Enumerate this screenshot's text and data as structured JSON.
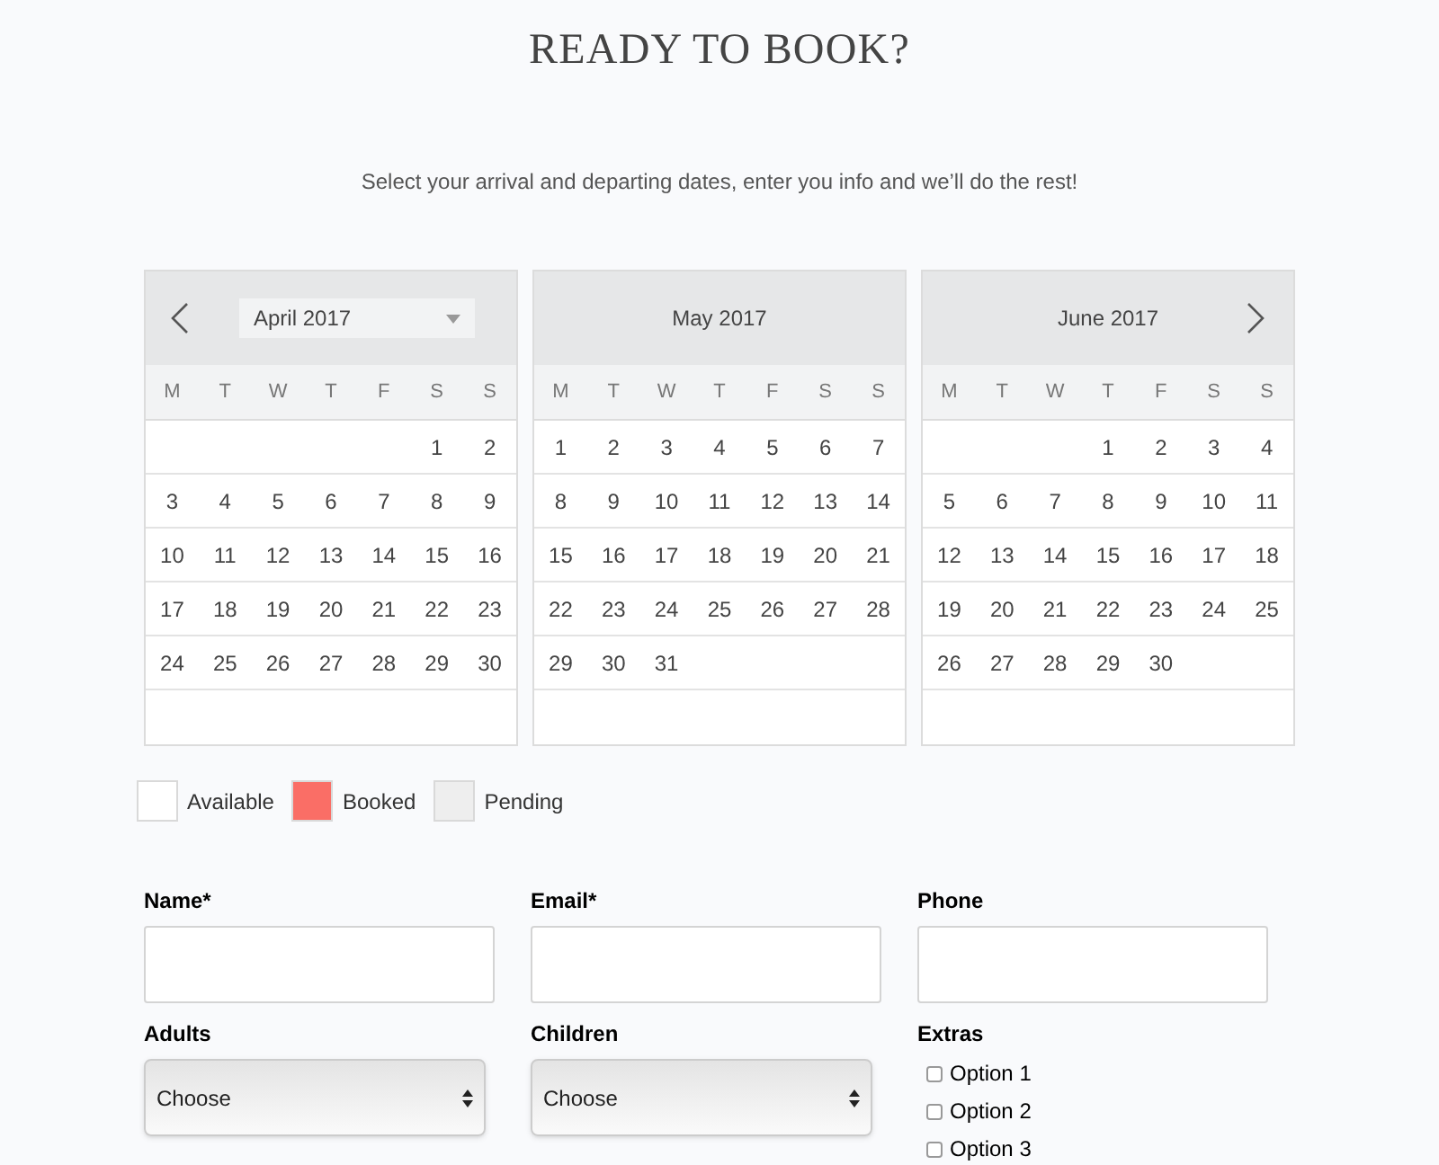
{
  "heading": "READY TO BOOK?",
  "intro": "Select your arrival and departing dates, enter you info and we’ll do the rest!",
  "calendar": {
    "months": [
      {
        "title": "April 2017",
        "kind": "dropdown",
        "weekdays": [
          "M",
          "T",
          "W",
          "T",
          "F",
          "S",
          "S"
        ],
        "weeks": [
          {
            "kind": "first",
            "days": [
              "1",
              "2"
            ]
          },
          {
            "kind": "full",
            "days": [
              "3",
              "4",
              "5",
              "6",
              "7",
              "8",
              "9"
            ]
          },
          {
            "kind": "full",
            "days": [
              "10",
              "11",
              "12",
              "13",
              "14",
              "15",
              "16"
            ]
          },
          {
            "kind": "full",
            "days": [
              "17",
              "18",
              "19",
              "20",
              "21",
              "22",
              "23"
            ]
          },
          {
            "kind": "full",
            "days": [
              "24",
              "25",
              "26",
              "27",
              "28",
              "29",
              "30"
            ]
          }
        ]
      },
      {
        "title": "May 2017",
        "kind": "plain",
        "weekdays": [
          "M",
          "T",
          "W",
          "T",
          "F",
          "S",
          "S"
        ],
        "weeks": [
          {
            "kind": "full",
            "days": [
              "1",
              "2",
              "3",
              "4",
              "5",
              "6",
              "7"
            ]
          },
          {
            "kind": "full",
            "days": [
              "8",
              "9",
              "10",
              "11",
              "12",
              "13",
              "14"
            ]
          },
          {
            "kind": "full",
            "days": [
              "15",
              "16",
              "17",
              "18",
              "19",
              "20",
              "21"
            ]
          },
          {
            "kind": "full",
            "days": [
              "22",
              "23",
              "24",
              "25",
              "26",
              "27",
              "28"
            ]
          },
          {
            "kind": "last",
            "days": [
              "29",
              "30",
              "31"
            ]
          }
        ]
      },
      {
        "title": "June 2017",
        "kind": "plain",
        "weekdays": [
          "M",
          "T",
          "W",
          "T",
          "F",
          "S",
          "S"
        ],
        "weeks": [
          {
            "kind": "first",
            "days": [
              "1",
              "2",
              "3",
              "4"
            ]
          },
          {
            "kind": "full",
            "days": [
              "5",
              "6",
              "7",
              "8",
              "9",
              "10",
              "11"
            ]
          },
          {
            "kind": "full",
            "days": [
              "12",
              "13",
              "14",
              "15",
              "16",
              "17",
              "18"
            ]
          },
          {
            "kind": "full",
            "days": [
              "19",
              "20",
              "21",
              "22",
              "23",
              "24",
              "25"
            ]
          },
          {
            "kind": "last",
            "days": [
              "26",
              "27",
              "28",
              "29",
              "30"
            ]
          }
        ]
      }
    ]
  },
  "legend": [
    {
      "label": "Available",
      "color": "#ffffff"
    },
    {
      "label": "Booked",
      "color": "#fa6e66"
    },
    {
      "label": "Pending",
      "color": "#eeeeee"
    }
  ],
  "form": {
    "text_fields": [
      {
        "label": "Name*"
      },
      {
        "label": "Email*"
      },
      {
        "label": "Phone"
      }
    ],
    "selects": [
      {
        "label": "Adults",
        "value": "Choose"
      },
      {
        "label": "Children",
        "value": "Choose"
      }
    ],
    "extras": {
      "label": "Extras",
      "options": [
        {
          "label": "Option 1",
          "checked": false
        },
        {
          "label": "Option 2",
          "checked": false
        },
        {
          "label": "Option 3",
          "checked": false
        }
      ]
    }
  }
}
